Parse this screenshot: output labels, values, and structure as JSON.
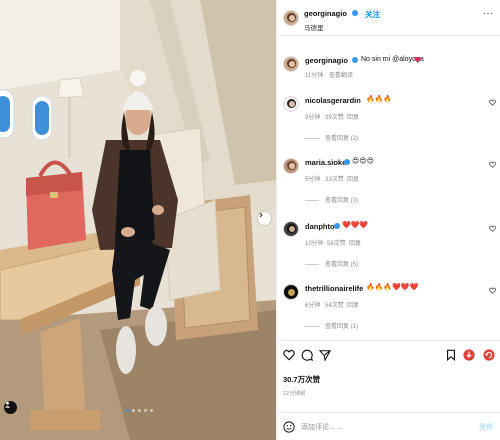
{
  "post": {
    "author": "georginagio",
    "follow_label": "关注",
    "location": "马德里",
    "caption_text": "No sin mi @aloyoga",
    "caption_time": "11分钟",
    "translate_label": "查看翻译"
  },
  "comments": [
    {
      "username": "nicolasgerardin",
      "text": "🔥🔥🔥",
      "time": "9分钟",
      "likes": "39次赞",
      "reply": "回复",
      "view_replies": "查看回复 (2)"
    },
    {
      "username": "maria.sioke",
      "text": "😍😍😍",
      "time": "5分钟",
      "likes": "33次赞",
      "reply": "回复",
      "view_replies": "查看回复 (3)"
    },
    {
      "username": "danphto",
      "text": "❤️❤️❤️",
      "time": "10分钟",
      "likes": "58次赞",
      "reply": "回复",
      "view_replies": "查看回复 (5)"
    },
    {
      "username": "thetrillionairelife",
      "text": "🔥🔥🔥❤️❤️❤️",
      "time": "6分钟",
      "likes": "54次赞",
      "reply": "回复",
      "view_replies": "查看回复 (1)"
    }
  ],
  "footer": {
    "likes": "30.7万次赞",
    "time": "12分钟前",
    "add_comment_placeholder": "添加评论……",
    "post_label": "发布"
  },
  "icons": {
    "like": "heart-icon",
    "comment": "comment-icon",
    "share": "share-icon",
    "save": "bookmark-icon",
    "download": "download-icon",
    "emoji": "emoji-icon"
  },
  "colors": {
    "link": "#0095f6",
    "verified": "#3897f0",
    "download_button": "#e0433c"
  }
}
